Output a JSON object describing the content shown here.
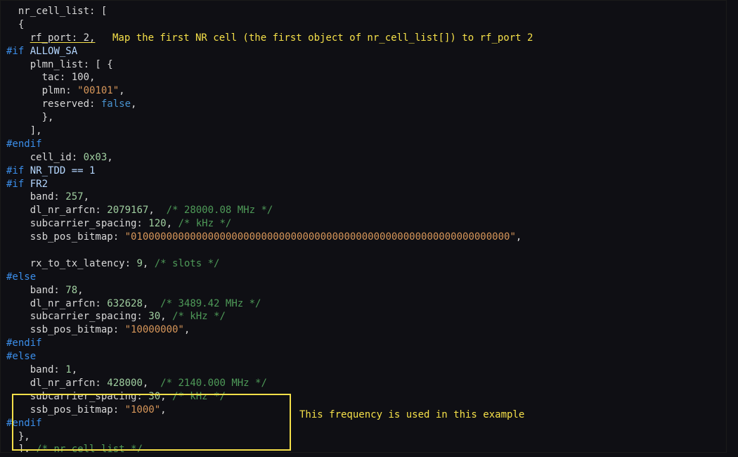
{
  "lines": {
    "l01_a": "  nr_cell_list: [",
    "l02_a": "  {",
    "l03_a": "    ",
    "l03_b": "rf_port: 2,",
    "note1": "Map the first NR cell (the first object of nr_cell_list[]) to rf_port 2",
    "l04_pp": "#if",
    "l04_id": " ALLOW_SA",
    "l05": "    plmn_list: [ {",
    "l06": "      tac: 100,",
    "l07_a": "      plmn: ",
    "l07_s": "\"00101\"",
    "l07_b": ",",
    "l08_a": "      reserved: ",
    "l08_b": "false",
    "l08_c": ",",
    "l09": "      },",
    "l10": "    ],",
    "l11_pp": "#endif",
    "l12_a": "    cell_id: ",
    "l12_n": "0x03",
    "l12_b": ",",
    "l13_pp": "#if",
    "l13_id": " NR_TDD == 1",
    "l14_pp": "#if",
    "l14_id": " FR2",
    "l15_a": "    band: ",
    "l15_n": "257",
    "l15_b": ",",
    "l16_a": "    dl_nr_arfcn: ",
    "l16_n": "632628",
    "l16_b": ",  ",
    "l16_c": "/* 3489.42 MHz */",
    "l16_n2": "2079167",
    "l16_c2": "/* 28000.08 MHz */",
    "l17_a": "    subcarrier_spacing: ",
    "l17_n": "120",
    "l17_b": ", ",
    "l17_c": "/* kHz */",
    "l18_a": "    ssb_pos_bitmap: ",
    "l18_s": "\"0100000000000000000000000000000000000000000000000000000000000000\"",
    "l18_b": ",",
    "l19_sp": " ",
    "l20_a": "    rx_to_tx_latency: ",
    "l20_n": "9",
    "l20_b": ", ",
    "l20_c": "/* slots */",
    "l21_pp": "#else",
    "l22_a": "    band: ",
    "l22_n": "78",
    "l22_b": ",",
    "l24_a": "    subcarrier_spacing: ",
    "l24_n": "30",
    "l24_b": ", ",
    "l24_c": "/* kHz */",
    "l25_a": "    ssb_pos_bitmap: ",
    "l25_s": "\"10000000\"",
    "l25_b": ",",
    "l26_pp": "#endif",
    "l27_pp": "#else",
    "l28_a": "    band: ",
    "l28_n": "1",
    "l28_b": ",",
    "l29_a": "    dl_nr_arfcn: ",
    "l29_n": "428000",
    "l29_b": ",  ",
    "l29_c": "/* 2140.000 MHz */",
    "note2": "This frequency is used in this example",
    "l30_a": "    subcarrier_spacing: ",
    "l30_n": "30",
    "l30_b": ", ",
    "l30_c": "/* kHz */",
    "l31_a": "    ssb_pos_bitmap: ",
    "l31_s": "\"1000\"",
    "l31_b": ",",
    "l32_pp": "#endif",
    "l33": "  },",
    "l34_a": "  ], ",
    "l34_c": "/* nr_cell_list */"
  }
}
